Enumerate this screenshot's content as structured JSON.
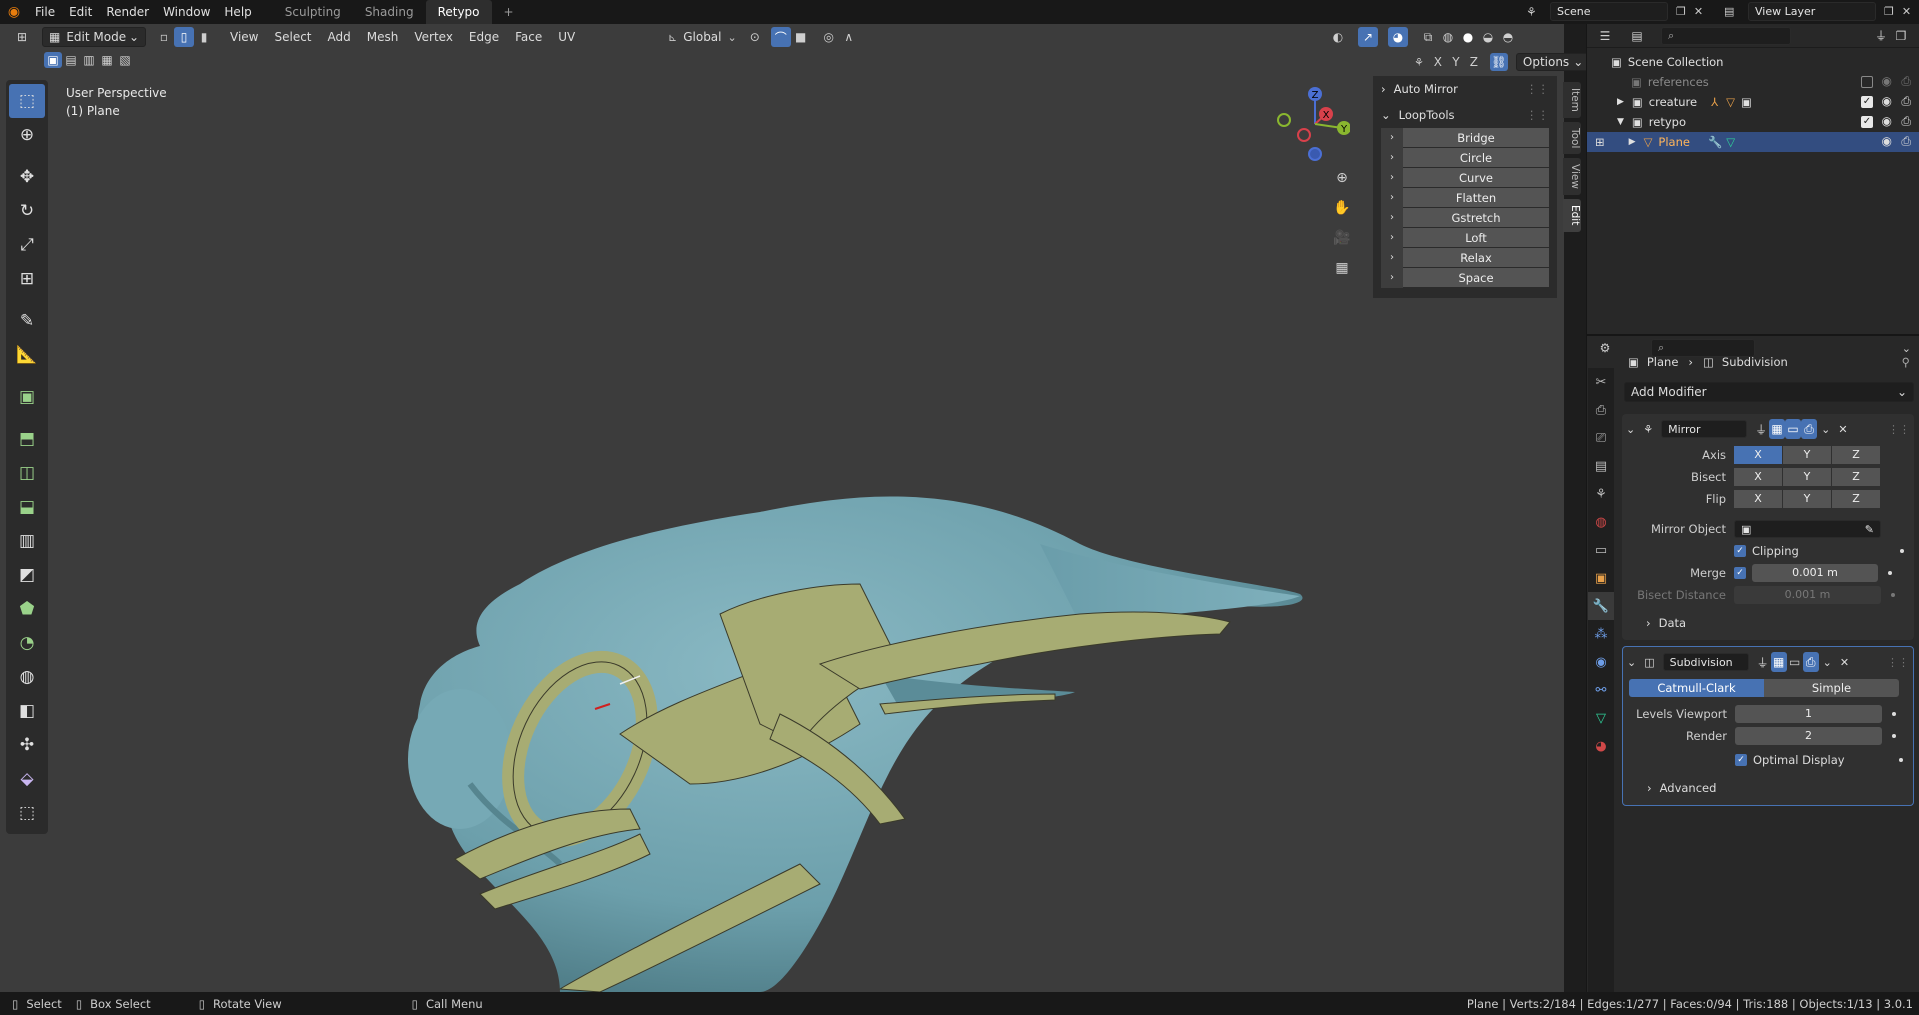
{
  "topbar": {
    "menus": [
      "File",
      "Edit",
      "Render",
      "Window",
      "Help"
    ],
    "workspaces": [
      "Sculpting",
      "Shading",
      "Retypo"
    ],
    "active_workspace": "Retypo",
    "add_symbol": "+",
    "scene": "Scene",
    "view_layer": "View Layer"
  },
  "viewport_header": {
    "mode": "Edit Mode",
    "menus": [
      "View",
      "Select",
      "Add",
      "Mesh",
      "Vertex",
      "Edge",
      "Face",
      "UV"
    ],
    "orientation": "Global",
    "mirror_axes": [
      "X",
      "Y",
      "Z"
    ],
    "options_label": "Options"
  },
  "viewport": {
    "perspective": "User Perspective",
    "object": "(1) Plane",
    "background_color": "#3c3c3c",
    "mesh_color": "#6ea1ad",
    "retopo_color": "#9fa46b"
  },
  "gizmo": {
    "x": "X",
    "y": "Y",
    "z": "Z"
  },
  "npanel": {
    "auto_mirror": "Auto Mirror",
    "looptools": "LoopTools",
    "buttons": [
      "Bridge",
      "Circle",
      "Curve",
      "Flatten",
      "Gstretch",
      "Loft",
      "Relax",
      "Space"
    ],
    "tabs": [
      "Item",
      "Tool",
      "View",
      "Edit"
    ],
    "active_tab": "Edit"
  },
  "outliner": {
    "search_placeholder": "",
    "root": "Scene Collection",
    "items": [
      {
        "label": "references",
        "indent": 1,
        "dim": true
      },
      {
        "label": "creature",
        "indent": 1
      },
      {
        "label": "retypo",
        "indent": 1
      },
      {
        "label": "Plane",
        "indent": 2,
        "selected": true
      }
    ]
  },
  "properties": {
    "breadcrumb_object": "Plane",
    "breadcrumb_modifier": "Subdivision",
    "add_modifier": "Add Modifier",
    "mirror": {
      "name": "Mirror",
      "axis_label": "Axis",
      "bisect_label": "Bisect",
      "flip_label": "Flip",
      "axes": [
        "X",
        "Y",
        "Z"
      ],
      "mirror_object_label": "Mirror Object",
      "clipping_label": "Clipping",
      "merge_label": "Merge",
      "merge_value": "0.001 m",
      "bisect_distance_label": "Bisect Distance",
      "bisect_distance_value": "0.001 m",
      "data_label": "Data"
    },
    "subdivision": {
      "name": "Subdivision",
      "catmull": "Catmull-Clark",
      "simple": "Simple",
      "levels_viewport_label": "Levels Viewport",
      "levels_viewport": "1",
      "render_label": "Render",
      "render": "2",
      "optimal_display": "Optimal Display",
      "advanced": "Advanced"
    }
  },
  "statusbar": {
    "select": "Select",
    "box_select": "Box Select",
    "rotate_view": "Rotate View",
    "call_menu": "Call Menu",
    "stats": "Plane | Verts:2/184 | Edges:1/277 | Faces:0/94 | Tris:188 | Objects:1/13 | 3.0.1"
  }
}
